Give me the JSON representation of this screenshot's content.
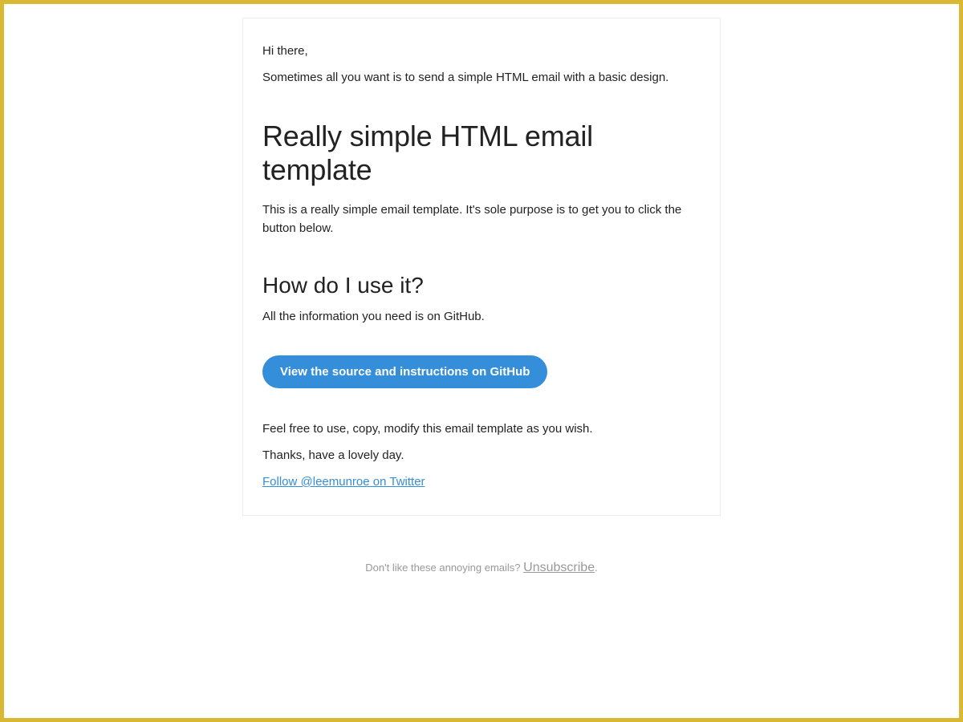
{
  "email": {
    "greeting": "Hi there,",
    "intro": "Sometimes all you want is to send a simple HTML email with a basic design.",
    "heading1": "Really simple HTML email template",
    "body1": "This is a really simple email template. It's sole purpose is to get you to click the button below.",
    "heading2": "How do I use it?",
    "githubInfo": "All the information you need is on GitHub.",
    "ctaLabel": "View the source and instructions on GitHub",
    "useText": "Feel free to use, copy, modify this email template as you wish.",
    "thanksText": "Thanks, have a lovely day.",
    "twitterLink": "Follow @leemunroe on Twitter"
  },
  "footer": {
    "dislikeText": "Don't like these annoying emails? ",
    "unsubscribeLabel": "Unsubscribe",
    "period": "."
  }
}
